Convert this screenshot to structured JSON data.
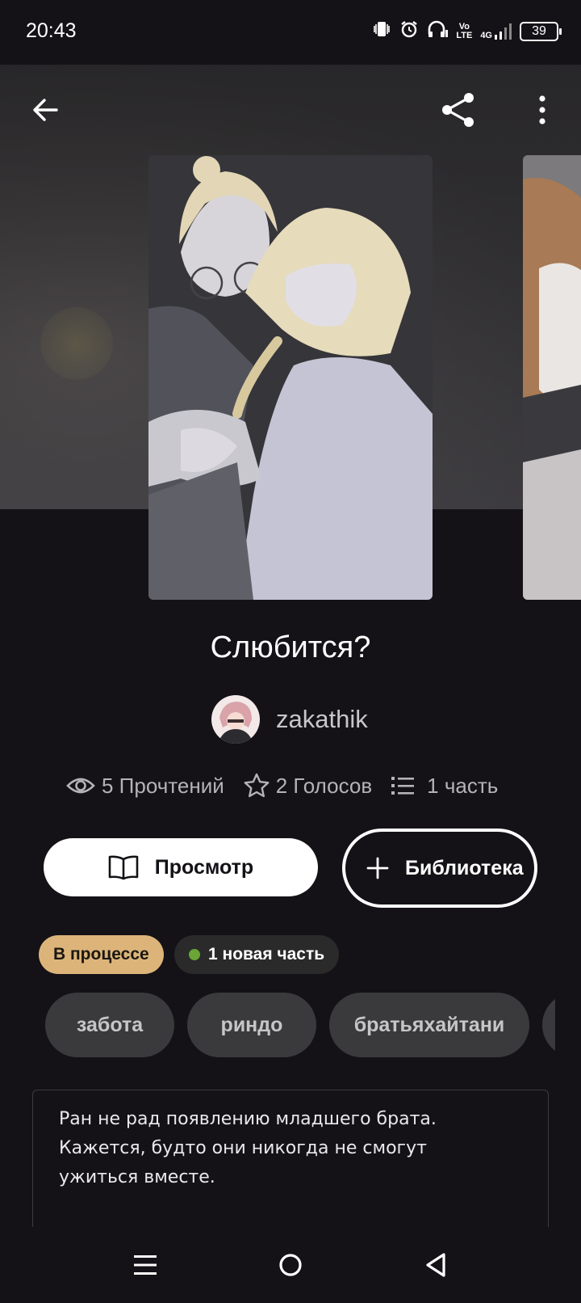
{
  "status_bar": {
    "time": "20:43",
    "volte": "Vo\nLTE",
    "network": "4G",
    "battery": "39"
  },
  "story": {
    "title": "Слюбится?",
    "author": "zakathik",
    "stats": {
      "reads": "5 Прочтений",
      "votes": "2 Голосов",
      "parts": "1 часть"
    }
  },
  "actions": {
    "view_label": "Просмотр",
    "library_label": "Библиотека"
  },
  "badges": {
    "status": "В процессе",
    "new_part": "1 новая часть"
  },
  "tags": [
    "забота",
    "риндо",
    "братьяхайтани"
  ],
  "description": "Ран не рад появлению младшего брата.\nКажется, будто они никогда не смогут\nужиться вместе.",
  "colors": {
    "background": "#141216",
    "status_badge": "#dcb47a",
    "new_dot": "#6aa535",
    "tag_bg": "#3a3a3c"
  },
  "icons": [
    "back-arrow-icon",
    "share-icon",
    "more-vertical-icon",
    "eye-icon",
    "star-icon",
    "list-icon",
    "book-icon",
    "plus-icon",
    "menu-nav-icon",
    "home-nav-icon",
    "back-nav-icon"
  ]
}
